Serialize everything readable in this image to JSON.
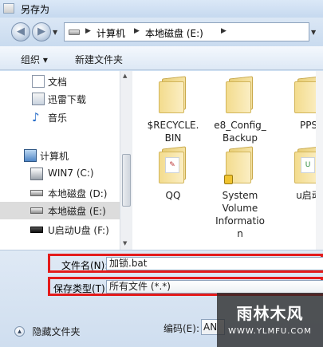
{
  "window": {
    "title": "另存为"
  },
  "address": {
    "segments": [
      "计算机",
      "本地磁盘 (E:)"
    ]
  },
  "toolbar": {
    "organize_label": "组织 ▾",
    "new_folder_label": "新建文件夹"
  },
  "nav": {
    "items": [
      {
        "label": "文档",
        "icon": "document-icon"
      },
      {
        "label": "迅雷下载",
        "icon": "download-folder-icon"
      },
      {
        "label": "音乐",
        "icon": "music-icon"
      },
      {
        "label": "计算机",
        "icon": "computer-icon"
      },
      {
        "label": "WIN7 (C:)",
        "icon": "system-drive-icon"
      },
      {
        "label": "本地磁盘 (D:)",
        "icon": "drive-icon"
      },
      {
        "label": "本地磁盘 (E:)",
        "icon": "drive-icon",
        "selected": true
      },
      {
        "label": "U启动U盘 (F:)",
        "icon": "usb-drive-icon"
      }
    ]
  },
  "files": [
    {
      "name": "$RECYCLE.\nBIN",
      "icon": "folder-icon"
    },
    {
      "name": "e8_Config_\nBackup",
      "icon": "folder-icon"
    },
    {
      "name": "PPS",
      "icon": "folder-icon"
    },
    {
      "name": "QQ",
      "icon": "folder-icon"
    },
    {
      "name": "System\nVolume\nInformatio\nn",
      "icon": "locked-folder-icon"
    },
    {
      "name": "u启动",
      "icon": "folder-icon"
    }
  ],
  "form": {
    "filename_label": "文件名(N):",
    "filename_value": "加锁.bat",
    "filetype_label": "保存类型(T):",
    "filetype_value": "所有文件  (*.*)",
    "encoding_label": "编码(E):",
    "encoding_value": "AN",
    "hide_folders_label": "隐藏文件夹"
  },
  "watermark": {
    "main": "雨林木风",
    "url": "WWW.YLMFU.COM"
  },
  "colors": {
    "highlight_border": "#e41b1b",
    "selected_item": "#dcdcdc",
    "chrome": "#cfe0f2"
  }
}
